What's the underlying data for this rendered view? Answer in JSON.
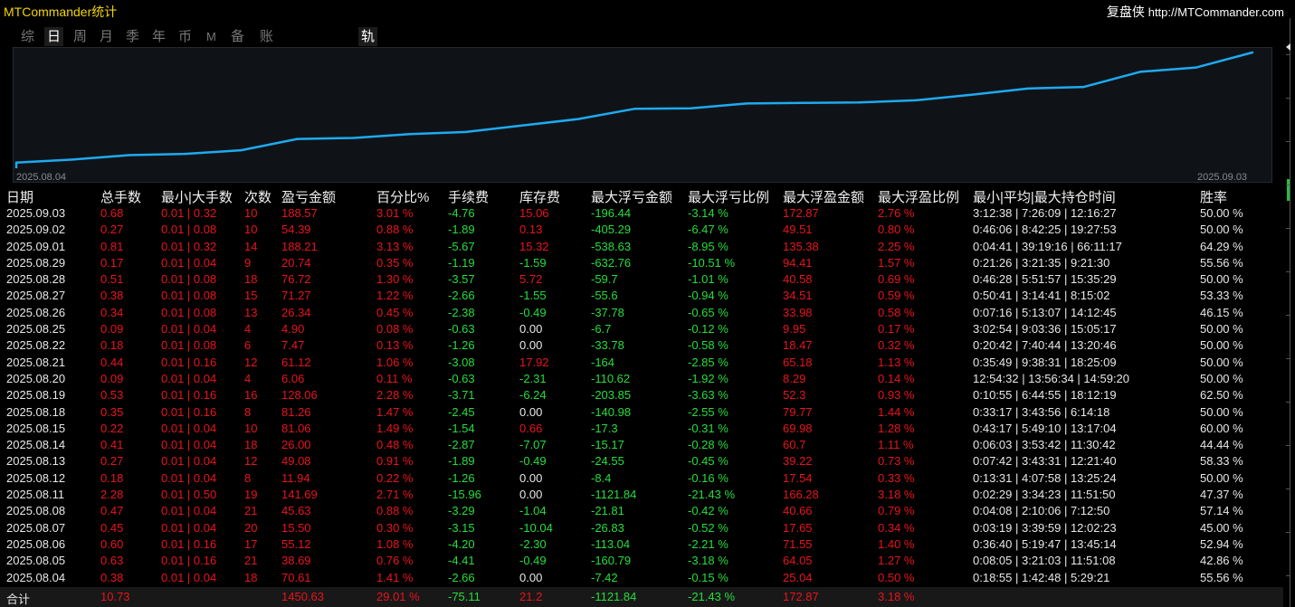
{
  "app": {
    "title": "MTCommander统计",
    "brand_name": "复盘侠",
    "brand_url": "http://MTCommander.com"
  },
  "tabs": [
    {
      "label": "综",
      "active": false
    },
    {
      "label": "日",
      "active": true
    },
    {
      "label": "周",
      "active": false
    },
    {
      "label": "月",
      "active": false
    },
    {
      "label": "季",
      "active": false
    },
    {
      "label": "年",
      "active": false
    },
    {
      "label": "币",
      "active": false
    },
    {
      "label": "M",
      "active": false
    },
    {
      "label": "备",
      "active": false
    },
    {
      "label": "账户",
      "active": false
    },
    {
      "label": "轨迹",
      "active": true
    }
  ],
  "chart_data": {
    "type": "line",
    "x": [
      "2025.08.04",
      "2025.08.05",
      "2025.08.06",
      "2025.08.07",
      "2025.08.08",
      "2025.08.11",
      "2025.08.12",
      "2025.08.13",
      "2025.08.14",
      "2025.08.15",
      "2025.08.18",
      "2025.08.19",
      "2025.08.20",
      "2025.08.21",
      "2025.08.22",
      "2025.08.25",
      "2025.08.26",
      "2025.08.27",
      "2025.08.28",
      "2025.08.29",
      "2025.09.01",
      "2025.09.02",
      "2025.09.03"
    ],
    "values": [
      70.61,
      109.3,
      164.42,
      179.92,
      225.55,
      367.24,
      379.18,
      428.26,
      454.26,
      535.32,
      616.58,
      744.64,
      750.7,
      811.82,
      819.29,
      824.19,
      850.53,
      921.8,
      998.52,
      1019.26,
      1207.47,
      1261.86,
      1450.43
    ],
    "x_start_label": "2025.08.04",
    "x_end_label": "2025.09.03",
    "color": "#1eaaf0",
    "grid": false
  },
  "table": {
    "columns": [
      "日期",
      "总手数",
      "最小|大手数",
      "次数",
      "盈亏金额",
      "百分比%",
      "手续费",
      "库存费",
      "最大浮亏金额",
      "最大浮亏比例",
      "最大浮盈金额",
      "最大浮盈比例",
      "最小|平均|最大持仓时间",
      "胜率"
    ],
    "rows": [
      [
        "2025.09.03",
        "0.68",
        "0.01 | 0.32",
        "10",
        "188.57",
        "3.01 %",
        "-4.76",
        "15.06",
        "-196.44",
        "-3.14 %",
        "172.87",
        "2.76 %",
        "3:12:38 | 7:26:09 | 12:16:27",
        "50.00 %"
      ],
      [
        "2025.09.02",
        "0.27",
        "0.01 | 0.08",
        "10",
        "54.39",
        "0.88 %",
        "-1.89",
        "0.13",
        "-405.29",
        "-6.47 %",
        "49.51",
        "0.80 %",
        "0:46:06 | 8:42:25 | 19:27:53",
        "50.00 %"
      ],
      [
        "2025.09.01",
        "0.81",
        "0.01 | 0.32",
        "14",
        "188.21",
        "3.13 %",
        "-5.67",
        "15.32",
        "-538.63",
        "-8.95 %",
        "135.38",
        "2.25 %",
        "0:04:41 | 39:19:16 | 66:11:17",
        "64.29 %"
      ],
      [
        "2025.08.29",
        "0.17",
        "0.01 | 0.04",
        "9",
        "20.74",
        "0.35 %",
        "-1.19",
        "-1.59",
        "-632.76",
        "-10.51 %",
        "94.41",
        "1.57 %",
        "0:21:26 | 3:21:35 | 9:21:30",
        "55.56 %"
      ],
      [
        "2025.08.28",
        "0.51",
        "0.01 | 0.08",
        "18",
        "76.72",
        "1.30 %",
        "-3.57",
        "5.72",
        "-59.7",
        "-1.01 %",
        "40.58",
        "0.69 %",
        "0:46:28 | 5:51:57 | 15:35:29",
        "50.00 %"
      ],
      [
        "2025.08.27",
        "0.38",
        "0.01 | 0.08",
        "15",
        "71.27",
        "1.22 %",
        "-2.66",
        "-1.55",
        "-55.6",
        "-0.94 %",
        "34.51",
        "0.59 %",
        "0:50:41 | 3:14:41 | 8:15:02",
        "53.33 %"
      ],
      [
        "2025.08.26",
        "0.34",
        "0.01 | 0.08",
        "13",
        "26.34",
        "0.45 %",
        "-2.38",
        "-0.49",
        "-37.78",
        "-0.65 %",
        "33.98",
        "0.58 %",
        "0:07:16 | 5:13:07 | 14:12:45",
        "46.15 %"
      ],
      [
        "2025.08.25",
        "0.09",
        "0.01 | 0.04",
        "4",
        "4.90",
        "0.08 %",
        "-0.63",
        "0.00",
        "-6.7",
        "-0.12 %",
        "9.95",
        "0.17 %",
        "3:02:54 | 9:03:36 | 15:05:17",
        "50.00 %"
      ],
      [
        "2025.08.22",
        "0.18",
        "0.01 | 0.08",
        "6",
        "7.47",
        "0.13 %",
        "-1.26",
        "0.00",
        "-33.78",
        "-0.58 %",
        "18.47",
        "0.32 %",
        "0:20:42 | 7:40:44 | 13:20:46",
        "50.00 %"
      ],
      [
        "2025.08.21",
        "0.44",
        "0.01 | 0.16",
        "12",
        "61.12",
        "1.06 %",
        "-3.08",
        "17.92",
        "-164",
        "-2.85 %",
        "65.18",
        "1.13 %",
        "0:35:49 | 9:38:31 | 18:25:09",
        "50.00 %"
      ],
      [
        "2025.08.20",
        "0.09",
        "0.01 | 0.04",
        "4",
        "6.06",
        "0.11 %",
        "-0.63",
        "-2.31",
        "-110.62",
        "-1.92 %",
        "8.29",
        "0.14 %",
        "12:54:32 | 13:56:34 | 14:59:20",
        "50.00 %"
      ],
      [
        "2025.08.19",
        "0.53",
        "0.01 | 0.16",
        "16",
        "128.06",
        "2.28 %",
        "-3.71",
        "-6.24",
        "-203.85",
        "-3.63 %",
        "52.3",
        "0.93 %",
        "0:10:55 | 6:44:55 | 18:12:19",
        "62.50 %"
      ],
      [
        "2025.08.18",
        "0.35",
        "0.01 | 0.16",
        "8",
        "81.26",
        "1.47 %",
        "-2.45",
        "0.00",
        "-140.98",
        "-2.55 %",
        "79.77",
        "1.44 %",
        "0:33:17 | 3:43:56 | 6:14:18",
        "50.00 %"
      ],
      [
        "2025.08.15",
        "0.22",
        "0.01 | 0.04",
        "10",
        "81.06",
        "1.49 %",
        "-1.54",
        "0.66",
        "-17.3",
        "-0.31 %",
        "69.98",
        "1.28 %",
        "0:43:17 | 5:49:10 | 13:17:04",
        "60.00 %"
      ],
      [
        "2025.08.14",
        "0.41",
        "0.01 | 0.04",
        "18",
        "26.00",
        "0.48 %",
        "-2.87",
        "-7.07",
        "-15.17",
        "-0.28 %",
        "60.7",
        "1.11 %",
        "0:06:03 | 3:53:42 | 11:30:42",
        "44.44 %"
      ],
      [
        "2025.08.13",
        "0.27",
        "0.01 | 0.04",
        "12",
        "49.08",
        "0.91 %",
        "-1.89",
        "-0.49",
        "-24.55",
        "-0.45 %",
        "39.22",
        "0.73 %",
        "0:07:42 | 3:43:31 | 12:21:40",
        "58.33 %"
      ],
      [
        "2025.08.12",
        "0.18",
        "0.01 | 0.04",
        "8",
        "11.94",
        "0.22 %",
        "-1.26",
        "0.00",
        "-8.4",
        "-0.16 %",
        "17.54",
        "0.33 %",
        "0:13:31 | 4:07:58 | 13:25:24",
        "50.00 %"
      ],
      [
        "2025.08.11",
        "2.28",
        "0.01 | 0.50",
        "19",
        "141.69",
        "2.71 %",
        "-15.96",
        "0.00",
        "-1121.84",
        "-21.43 %",
        "166.28",
        "3.18 %",
        "0:02:29 | 3:34:23 | 11:51:50",
        "47.37 %"
      ],
      [
        "2025.08.08",
        "0.47",
        "0.01 | 0.04",
        "21",
        "45.63",
        "0.88 %",
        "-3.29",
        "-1.04",
        "-21.81",
        "-0.42 %",
        "40.66",
        "0.79 %",
        "0:04:08 | 2:10:06 | 7:12:50",
        "57.14 %"
      ],
      [
        "2025.08.07",
        "0.45",
        "0.01 | 0.04",
        "20",
        "15.50",
        "0.30 %",
        "-3.15",
        "-10.04",
        "-26.83",
        "-0.52 %",
        "17.65",
        "0.34 %",
        "0:03:19 | 3:39:59 | 12:02:23",
        "45.00 %"
      ],
      [
        "2025.08.06",
        "0.60",
        "0.01 | 0.16",
        "17",
        "55.12",
        "1.08 %",
        "-4.20",
        "-2.30",
        "-113.04",
        "-2.21 %",
        "71.55",
        "1.40 %",
        "0:36:40 | 5:19:47 | 13:45:14",
        "52.94 %"
      ],
      [
        "2025.08.05",
        "0.63",
        "0.01 | 0.16",
        "21",
        "38.69",
        "0.76 %",
        "-4.41",
        "-0.49",
        "-160.79",
        "-3.18 %",
        "64.05",
        "1.27 %",
        "0:08:05 | 3:21:03 | 11:51:08",
        "42.86 %"
      ],
      [
        "2025.08.04",
        "0.38",
        "0.01 | 0.04",
        "18",
        "70.61",
        "1.41 %",
        "-2.66",
        "0.00",
        "-7.42",
        "-0.15 %",
        "25.04",
        "0.50 %",
        "0:18:55 | 1:42:48 | 5:29:21",
        "55.56 %"
      ]
    ],
    "total": [
      "合计",
      "10.73",
      "",
      "",
      "1450.63",
      "29.01 %",
      "-75.11",
      "21.2",
      "-1121.84",
      "-21.43 %",
      "172.87",
      "3.18 %",
      "",
      ""
    ]
  },
  "colors": {
    "positive": "#e8141c",
    "negative": "#26dd3c",
    "neutral": "#e8e8e8",
    "title": "#f2d400",
    "line": "#1eaaf0"
  }
}
